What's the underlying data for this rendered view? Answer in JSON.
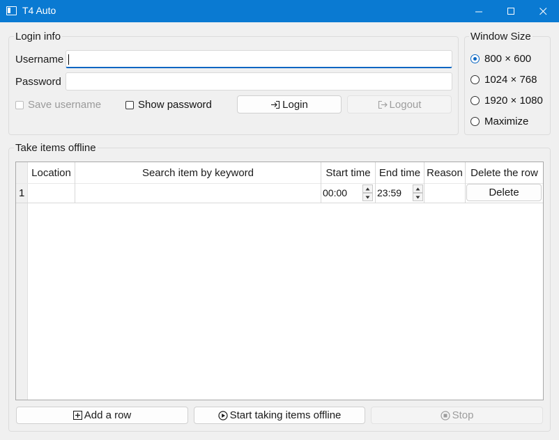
{
  "window": {
    "title": "T4 Auto",
    "minimize_icon": "minimize-icon",
    "maximize_icon": "maximize-icon",
    "close_icon": "close-icon"
  },
  "login": {
    "group_title": "Login info",
    "username_label": "Username",
    "username_value": "",
    "password_label": "Password",
    "password_value": "",
    "save_username_label": "Save username",
    "save_username_checked": false,
    "show_password_label": "Show password",
    "show_password_checked": false,
    "login_button": "Login",
    "logout_button": "Logout"
  },
  "window_size": {
    "group_title": "Window Size",
    "options": [
      "800 × 600",
      "1024 × 768",
      "1920 × 1080",
      "Maximize"
    ],
    "selected": "800 × 600"
  },
  "offline": {
    "group_title": "Take items offline",
    "columns": [
      "Location",
      "Search item by keyword",
      "Start time",
      "End time",
      "Reason",
      "Delete the row"
    ],
    "rows": [
      {
        "row_number": "1",
        "location": "",
        "keyword": "",
        "start_time": "00:00",
        "end_time": "23:59",
        "reason": "",
        "delete_button": "Delete"
      }
    ]
  },
  "actions": {
    "add_row_button": "Add a row",
    "start_button": "Start taking items offline",
    "stop_button": "Stop"
  },
  "colors": {
    "titlebar": "#0a7ad2",
    "accent": "#0a66c2",
    "background": "#f0f0f0"
  }
}
